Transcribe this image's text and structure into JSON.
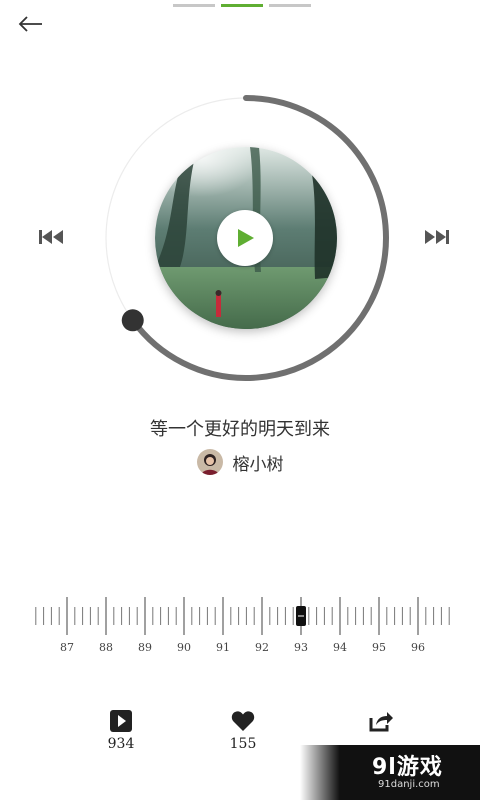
{
  "song": {
    "title": "等一个更好的明天到来"
  },
  "author": {
    "name": "榕小树"
  },
  "player": {
    "progress_fraction": 0.65
  },
  "pager": {
    "count": 3,
    "active_index": 1
  },
  "tuner": {
    "labels": [
      "87",
      "88",
      "89",
      "90",
      "91",
      "92",
      "93",
      "94",
      "95",
      "96"
    ],
    "selected": "93"
  },
  "stats": {
    "plays": "934",
    "likes": "155"
  },
  "watermark": {
    "main": "9l游戏",
    "sub": "91danji.com"
  },
  "colors": {
    "accent": "#5fae32",
    "ring": "#707070",
    "knob": "#333333"
  },
  "icons": {
    "back": "arrow-left-icon",
    "prev": "skip-previous-icon",
    "next": "skip-next-icon",
    "play": "play-icon",
    "plays": "play-square-icon",
    "likes": "heart-icon",
    "share": "share-icon"
  }
}
